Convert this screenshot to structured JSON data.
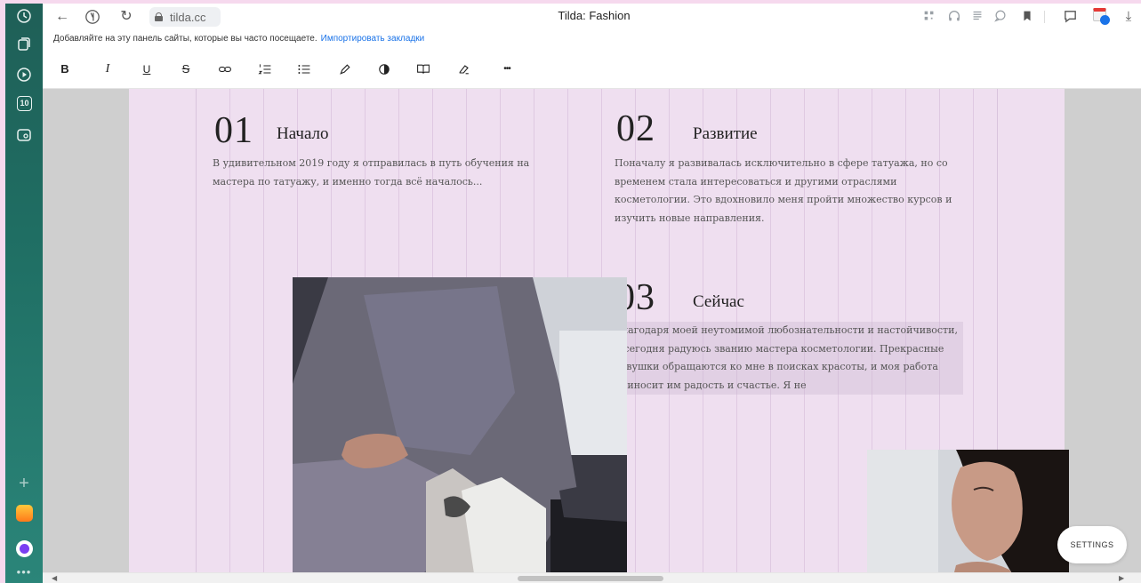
{
  "browser": {
    "url": "tilda.cc",
    "tab_title": "Tilda: Fashion",
    "sidebar_badge": "10"
  },
  "bookmarks": {
    "prompt": "Добавляйте на эту панель сайты, которые вы часто посещаете.",
    "import_link": "Импортировать закладки"
  },
  "toolbar": {
    "bold": "B",
    "italic": "I",
    "underline": "U",
    "strike": "S",
    "more": "•••"
  },
  "sections": [
    {
      "number": "01",
      "title": "Начало",
      "text": "В удивительном 2019 году я отправилась в путь обучения на мастера по татуажу, и именно тогда всё началось..."
    },
    {
      "number": "02",
      "title": "Развитие",
      "text": "Поначалу я развивалась исключительно в сфере татуажа, но со временем стала интересоваться и другими отраслями косметологии. Это вдохновило меня пройти множество курсов и изучить новые направления."
    },
    {
      "number": "03",
      "title": "Сейчас",
      "text": "Благодаря моей неутомимой любознательности и настойчивости, я сегодня радуюсь званию мастера косметологии. Прекрасные девушки обращаются ко мне в поисках красоты, и моя работа приносит им радость и счастье. Я не"
    }
  ],
  "settings_button": "SETTINGS"
}
